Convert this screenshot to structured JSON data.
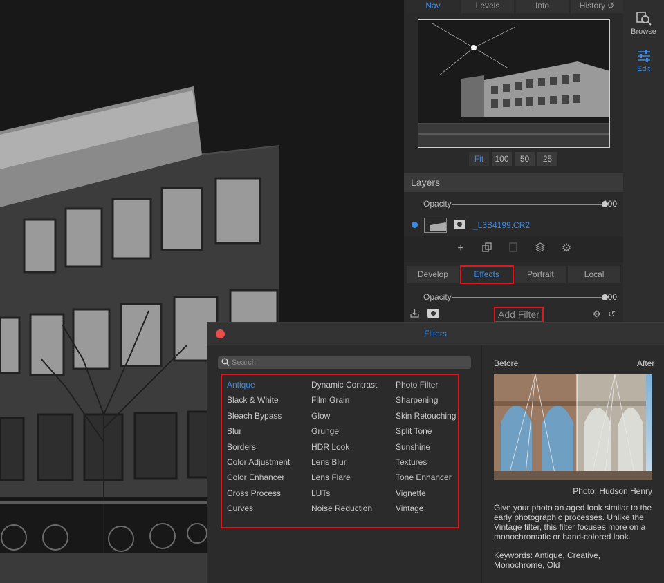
{
  "panel": {
    "tabs": [
      {
        "label": "Nav"
      },
      {
        "label": "Levels"
      },
      {
        "label": "Info"
      },
      {
        "label": "History"
      }
    ],
    "zoom": [
      "Fit",
      "100",
      "50",
      "25"
    ],
    "layers": {
      "title": "Layers",
      "opacity_label": "Opacity",
      "opacity_value": "100",
      "layer_name": "_L3B4199.CR2"
    },
    "filter_tabs": [
      "Develop",
      "Effects",
      "Portrait",
      "Local"
    ],
    "effects": {
      "opacity_label": "Opacity",
      "opacity_value": "100",
      "add_filter": "Add Filter"
    }
  },
  "rail": {
    "browse": "Browse",
    "edit": "Edit"
  },
  "dialog": {
    "title": "Filters",
    "search_placeholder": "Search",
    "columns": [
      [
        "Antique",
        "Black & White",
        "Bleach Bypass",
        "Blur",
        "Borders",
        "Color Adjustment",
        "Color Enhancer",
        "Cross Process",
        "Curves"
      ],
      [
        "Dynamic Contrast",
        "Film Grain",
        "Glow",
        "Grunge",
        "HDR Look",
        "Lens Blur",
        "Lens Flare",
        "LUTs",
        "Noise Reduction"
      ],
      [
        "Photo Filter",
        "Sharpening",
        "Skin Retouching",
        "Split Tone",
        "Sunshine",
        "Textures",
        "Tone Enhancer",
        "Vignette",
        "Vintage"
      ]
    ],
    "selected": "Antique",
    "before_label": "Before",
    "after_label": "After",
    "credit": "Photo: Hudson Henry",
    "description": "Give your photo an aged look similar to the early photographic processes. Unlike the Vintage filter, this filter focuses more on a monochromatic or hand-colored look.",
    "keywords": "Keywords: Antique, Creative, Monochrome, Old"
  },
  "colors": {
    "accent": "#3b8ae6",
    "highlight": "#e3151d",
    "close": "#ef4b4b"
  }
}
